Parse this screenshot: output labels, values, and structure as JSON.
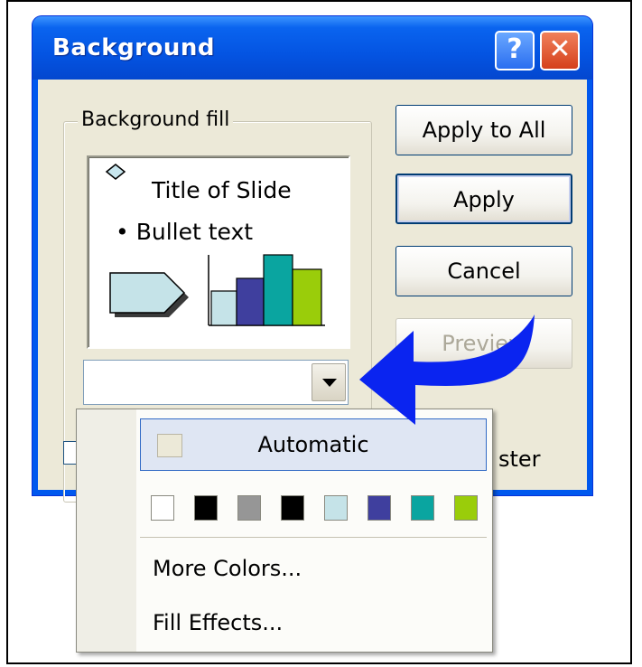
{
  "dialog": {
    "title": "Background",
    "help_glyph": "?",
    "close_glyph": "✕"
  },
  "group": {
    "label": "Background fill"
  },
  "preview": {
    "title": "Title of Slide",
    "bullet": "• Bullet text"
  },
  "buttons": {
    "apply_all": "Apply to All",
    "apply": "Apply",
    "cancel": "Cancel",
    "preview": "Preview"
  },
  "omit_label": "ster",
  "popup": {
    "automatic": "Automatic",
    "more_colors": "More Colors...",
    "fill_effects": "Fill Effects...",
    "swatches": [
      "#ffffff",
      "#000000",
      "#969696",
      "#000000",
      "#c5e3e8",
      "#3f3f9e",
      "#0aa5a0",
      "#9acd0a"
    ]
  },
  "colors": {
    "title_bar": "#0454e2",
    "dialog_face": "#ece9d8",
    "arrow": "#0a24f0",
    "highlight": "#316ac5"
  }
}
